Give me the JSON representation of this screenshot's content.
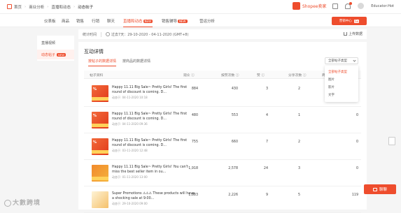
{
  "breadcrumb": {
    "home": "首页",
    "level1": "商业分析",
    "level2": "直播和动态",
    "current": "动态帖子"
  },
  "brand": {
    "name": "Shopee卖家"
  },
  "user": {
    "name": "Educator:Hot"
  },
  "nav": {
    "tabs": [
      {
        "label": "仪表板",
        "active": false,
        "badge": ""
      },
      {
        "label": "商品",
        "active": false,
        "badge": ""
      },
      {
        "label": "销售",
        "active": false,
        "badge": ""
      },
      {
        "label": "行销",
        "active": false,
        "badge": ""
      },
      {
        "label": "聊天",
        "active": false,
        "badge": ""
      },
      {
        "label": "直播和动态",
        "active": true,
        "badge": "NEW"
      },
      {
        "label": "销售辅导",
        "active": false,
        "badge": "NEW"
      },
      {
        "label": "营运分析",
        "active": false,
        "badge": ""
      }
    ]
  },
  "promo": {
    "label": "营销中心",
    "tag": "Go"
  },
  "timebar": {
    "label": "统计时间",
    "range": "过去7天：29-10-2020 - 04-11-2020 (GMT+8)",
    "export": "上传数据"
  },
  "sidebar": {
    "items": [
      {
        "label": "直播视频",
        "badge": ""
      },
      {
        "label": "动态帖子",
        "badge": "NEW"
      }
    ]
  },
  "main": {
    "title": "互动详情",
    "subtabs": [
      {
        "label": "按帖子的数据详情"
      },
      {
        "label": "按商品的数据详情"
      }
    ],
    "filter": {
      "value": "全部帖子类型"
    },
    "dropdown": [
      "全部帖子类型",
      "图片",
      "影片",
      "文字"
    ],
    "table": {
      "headers": [
        "帖子资料",
        "观众",
        "按赞次数",
        "赞",
        "分享次数",
        "商品链接"
      ],
      "rows": [
        {
          "title": "Happy 11.11 Big Sale~ Pretty Girls! The first round of discount is coming. D...",
          "date": "动态于: 04-11-2020 10:18",
          "viewers": "884",
          "likes": "430",
          "c3": "3",
          "shares": "2",
          "c5": ""
        },
        {
          "title": "Happy 11.11 Big Sale~ Pretty Girls! The first round of discount is coming. D...",
          "date": "动态于: 04-11-2020 09:36",
          "viewers": "480",
          "likes": "553",
          "c3": "4",
          "shares": "1",
          "c5": "0"
        },
        {
          "title": "Happy 11.11 Big Sale~ Pretty Girls! The first round of discount is coming. D...",
          "date": "动态于: 03-11-2020 12:48",
          "viewers": "755",
          "likes": "660",
          "c3": "7",
          "shares": "2",
          "c5": "0"
        },
        {
          "title": "Happy 11.11 Big Sale~ Pretty Girls! You can't miss the best seller item in ou...",
          "date": "动态于: 01-11-2020 13:00",
          "viewers": "1,918",
          "likes": "2,578",
          "c3": "24",
          "shares": "3",
          "c5": "0"
        },
        {
          "title": "Super Promotions ⚠⚠⚠ These products will have a shocking sale at 9:00...",
          "date": "动态于: 29-10-2020 09:00",
          "viewers": "1,883",
          "likes": "2,226",
          "c3": "9",
          "shares": "5",
          "c5": "119"
        }
      ]
    }
  },
  "chat": {
    "label": "聊聊"
  },
  "watermark": {
    "text": "大數跨境"
  },
  "colors": {
    "accent": "#ee4d2d",
    "background": "#f5f5f5"
  }
}
